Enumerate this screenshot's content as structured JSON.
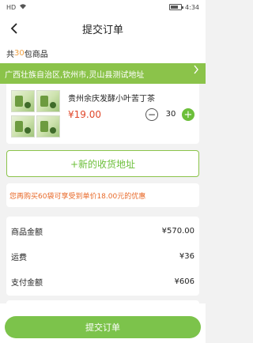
{
  "status_bar": {
    "signal": "HD",
    "wifi_icon": "wifi-icon",
    "battery_icon": "battery-icon",
    "time": "4:34"
  },
  "header": {
    "back_icon": "chevron-left-icon",
    "title": "提交订单"
  },
  "count": {
    "prefix": "共",
    "number": "30",
    "suffix": "包商品"
  },
  "address": {
    "text": "广西壮族自治区,钦州市,灵山县测试地址",
    "chevron_icon": "chevron-right-icon"
  },
  "product": {
    "name": "贵州余庆发酵小叶苦丁茶",
    "price": "¥19.00",
    "quantity": "30",
    "minus_label": "−",
    "plus_label": "+"
  },
  "new_address_button": "+新的收货地址",
  "promo": "您再购买60袋可享受到单价18.00元的优惠",
  "summary": {
    "rows": [
      {
        "label": "商品金额",
        "value": "¥570.00"
      },
      {
        "label": "运费",
        "value": "¥36"
      },
      {
        "label": "支付金额",
        "value": "¥606"
      }
    ]
  },
  "submit_button": "提交订单",
  "colors": {
    "accent_green": "#8bc34a",
    "price_red": "#e0472a",
    "promo_orange": "#e86a2a"
  }
}
